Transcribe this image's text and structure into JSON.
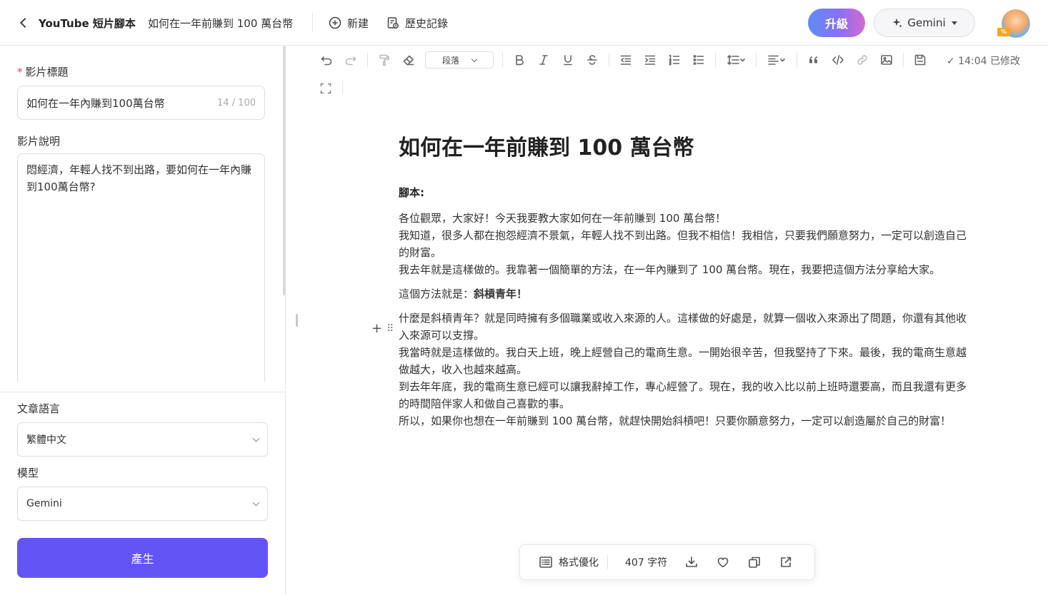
{
  "header": {
    "back_label": "YouTube 短片腳本",
    "doc_name": "如何在一年前賺到 100 萬台幣",
    "new_label": "新建",
    "history_label": "歷史記錄",
    "upgrade_label": "升級",
    "model_label": "Gemini",
    "avatar_badge": "%"
  },
  "left_panel": {
    "title_label": "影片標題",
    "title_value": "如何在一年內賺到100萬台幣",
    "title_count": "14 / 100",
    "desc_label": "影片說明",
    "desc_value": "悶經濟，年輕人找不到出路，要如何在一年內賺到100萬台幣?",
    "language_label": "文章語言",
    "language_value": "繁體中文",
    "model_label": "模型",
    "model_value": "Gemini",
    "generate_label": "產生"
  },
  "toolbar": {
    "paragraph_label": "段落",
    "saved_status": "✓ 14:04 已修改"
  },
  "document": {
    "title": "如何在一年前賺到 100 萬台幣",
    "script_label": "腳本:",
    "intro": [
      "各位觀眾，大家好！今天我要教大家如何在一年前賺到 100 萬台幣！",
      "我知道，很多人都在抱怨經濟不景氣，年輕人找不到出路。但我不相信！我相信，只要我們願意努力，一定可以創造自己的財富。",
      "我去年就是這樣做的。我靠著一個簡單的方法，在一年內賺到了 100 萬台幣。現在，我要把這個方法分享給大家。"
    ],
    "method_prefix": "這個方法就是：",
    "method_bold": "斜槓青年！",
    "body": [
      "什麼是斜槓青年？就是同時擁有多個職業或收入來源的人。這樣做的好處是，就算一個收入來源出了問題，你還有其他收入來源可以支撐。",
      "我當時就是這樣做的。我白天上班，晚上經營自己的電商生意。一開始很辛苦，但我堅持了下來。最後，我的電商生意越做越大，收入也越來越高。",
      "到去年年底，我的電商生意已經可以讓我辭掉工作，專心經營了。現在，我的收入比以前上班時還要高，而且我還有更多的時間陪伴家人和做自己喜歡的事。",
      "所以，如果你也想在一年前賺到 100 萬台幣，就趕快開始斜槓吧！只要你願意努力，一定可以創造屬於自己的財富！"
    ]
  },
  "bottom_bar": {
    "format_label": "格式優化",
    "char_count": "407 字符"
  },
  "colors": {
    "primary": "#6355f5",
    "upgrade_gradient": [
      "#5c8df5",
      "#8a6ff3",
      "#d56ad0"
    ],
    "required": "#e5484d"
  }
}
